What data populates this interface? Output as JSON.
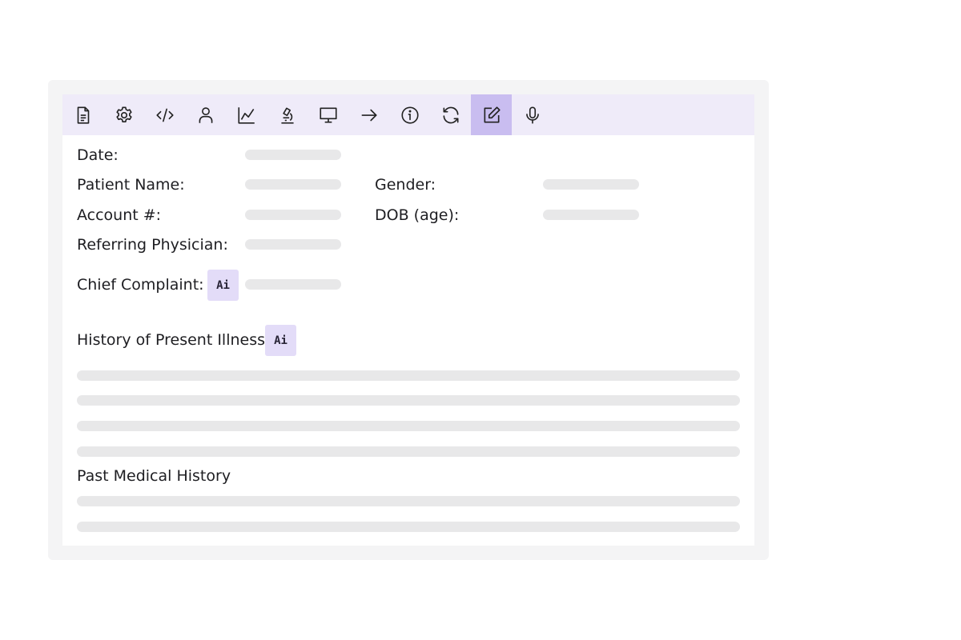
{
  "toolbar": {
    "icons": [
      "document-icon",
      "settings-icon",
      "code-icon",
      "user-icon",
      "chart-icon",
      "microscope-icon",
      "monitor-icon",
      "arrow-right-icon",
      "info-icon",
      "refresh-icon",
      "edit-icon",
      "microphone-icon"
    ],
    "active": "edit-icon"
  },
  "fields": {
    "date_label": "Date:",
    "patient_name_label": "Patient Name:",
    "gender_label": "Gender:",
    "account_label": "Account #:",
    "dob_label": "DOB (age):",
    "referring_label": "Referring Physician:",
    "chief_complaint_label": "Chief Complaint:"
  },
  "sections": {
    "hpi_title": "History of Present Illness",
    "pmh_title": "Past Medical History"
  },
  "ai_badge": "Ai",
  "colors": {
    "toolbar_bg": "#efebf9",
    "active_bg": "#c9bdf0",
    "ai_bg": "#e3dcf8",
    "skeleton": "#e8e8e9"
  }
}
